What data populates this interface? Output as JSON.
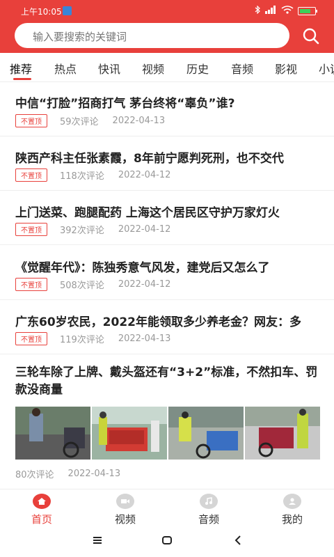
{
  "status": {
    "time": "上午10:05",
    "icons": [
      "bluetooth-icon",
      "signal-icon",
      "wifi-icon",
      "battery-icon"
    ]
  },
  "search": {
    "placeholder": "输入要搜索的关键词"
  },
  "tabs": [
    {
      "label": "推荐"
    },
    {
      "label": "热点"
    },
    {
      "label": "快讯"
    },
    {
      "label": "视频"
    },
    {
      "label": "历史"
    },
    {
      "label": "音频"
    },
    {
      "label": "影视"
    },
    {
      "label": "小说"
    }
  ],
  "news": [
    {
      "title": "中信“打脸”招商打气 茅台终将“辜负”谁?",
      "tag": "不置顶",
      "comments": "59次评论",
      "date": "2022-04-13"
    },
    {
      "title": "陕西产科主任张素霞，8年前宁愿判死刑，也不交代",
      "tag": "不置顶",
      "comments": "118次评论",
      "date": "2022-04-12"
    },
    {
      "title": "上门送菜、跑腿配药 上海这个居民区守护万家灯火",
      "tag": "不置顶",
      "comments": "392次评论",
      "date": "2022-04-12"
    },
    {
      "title": "《觉醒年代》：陈独秀意气风发，建党后又怎么了",
      "tag": "不置顶",
      "comments": "508次评论",
      "date": "2022-04-12"
    },
    {
      "title": "广东60岁农民，2022年能领取多少养老金？网友：多",
      "tag": "不置顶",
      "comments": "119次评论",
      "date": "2022-04-13"
    }
  ],
  "feature": {
    "title": "三轮车除了上牌、戴头盔还有“3+2”标准，不然扣车、罚款没商量",
    "comments": "80次评论",
    "date": "2022-04-13"
  },
  "bottom_nav": [
    {
      "label": "首页",
      "icon": "home-icon"
    },
    {
      "label": "视频",
      "icon": "video-icon"
    },
    {
      "label": "音频",
      "icon": "music-icon"
    },
    {
      "label": "我的",
      "icon": "user-icon"
    }
  ],
  "colors": {
    "brand": "#e8403b",
    "inactive_icon": "#d5d5d5"
  }
}
